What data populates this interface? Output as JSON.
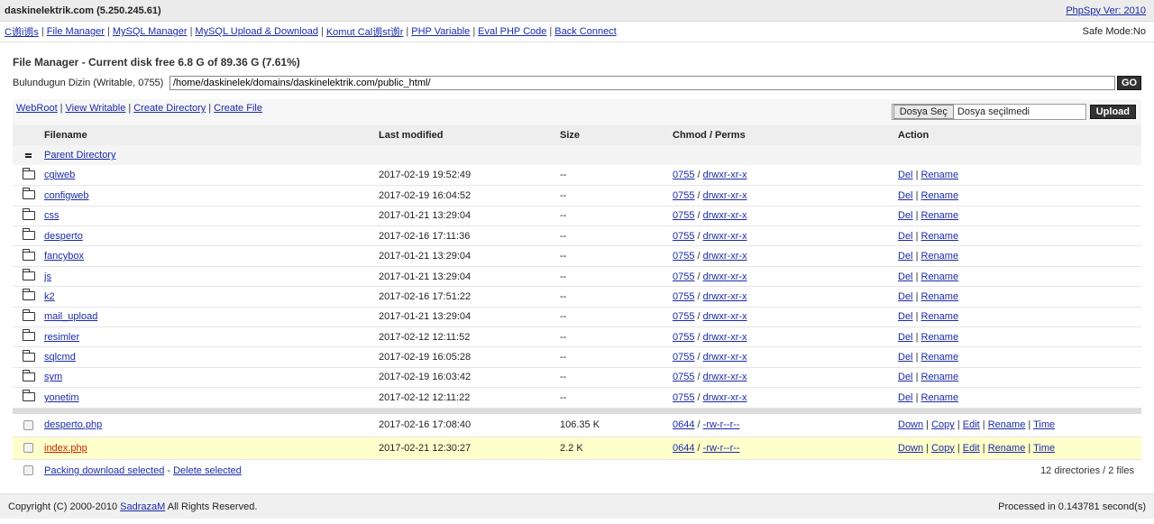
{
  "header": {
    "host": "daskinelektrik.com (5.250.245.61)",
    "version_link": "PhpSpy Ver: 2010"
  },
  "nav": {
    "items": [
      "C谫i谫s",
      "File Manager",
      "MySQL Manager",
      "MySQL Upload & Download",
      "Komut Cal谫st谫r",
      "PHP Variable",
      "Eval PHP Code",
      "Back Connect"
    ],
    "separator": "|",
    "safe_mode": "Safe Mode:No"
  },
  "main": {
    "title": "File Manager - Current disk free 6.8 G of 89.36 G (7.61%)",
    "dir_label": "Bulundugun Dizin (Writable, 0755)",
    "dir_value": "/home/daskinelek/domains/daskinelektrik.com/public_html/",
    "go_label": "GO"
  },
  "toolbar": {
    "links": [
      "WebRoot",
      "View Writable",
      "Create Directory",
      "Create File"
    ],
    "file_button": "Dosya Seç",
    "file_status": "Dosya seçilmedi",
    "upload_label": "Upload"
  },
  "table": {
    "headers": [
      "Filename",
      "Last modified",
      "Size",
      "Chmod / Perms",
      "Action"
    ],
    "parent": "Parent Directory",
    "directories": [
      {
        "name": "cgiweb",
        "modified": "2017-02-19 19:52:49",
        "size": "--",
        "chmod": "0755",
        "perms": "drwxr-xr-x"
      },
      {
        "name": "configweb",
        "modified": "2017-02-19 16:04:52",
        "size": "--",
        "chmod": "0755",
        "perms": "drwxr-xr-x"
      },
      {
        "name": "css",
        "modified": "2017-01-21 13:29:04",
        "size": "--",
        "chmod": "0755",
        "perms": "drwxr-xr-x"
      },
      {
        "name": "desperto",
        "modified": "2017-02-16 17:11:36",
        "size": "--",
        "chmod": "0755",
        "perms": "drwxr-xr-x"
      },
      {
        "name": "fancybox",
        "modified": "2017-01-21 13:29:04",
        "size": "--",
        "chmod": "0755",
        "perms": "drwxr-xr-x"
      },
      {
        "name": "js",
        "modified": "2017-01-21 13:29:04",
        "size": "--",
        "chmod": "0755",
        "perms": "drwxr-xr-x"
      },
      {
        "name": "k2",
        "modified": "2017-02-16 17:51:22",
        "size": "--",
        "chmod": "0755",
        "perms": "drwxr-xr-x"
      },
      {
        "name": "mail_upload",
        "modified": "2017-01-21 13:29:04",
        "size": "--",
        "chmod": "0755",
        "perms": "drwxr-xr-x"
      },
      {
        "name": "resimler",
        "modified": "2017-02-12 12:11:52",
        "size": "--",
        "chmod": "0755",
        "perms": "drwxr-xr-x"
      },
      {
        "name": "sqlcmd",
        "modified": "2017-02-19 16:05:28",
        "size": "--",
        "chmod": "0755",
        "perms": "drwxr-xr-x"
      },
      {
        "name": "sym",
        "modified": "2017-02-19 16:03:42",
        "size": "--",
        "chmod": "0755",
        "perms": "drwxr-xr-x"
      },
      {
        "name": "yonetim",
        "modified": "2017-02-12 12:11:22",
        "size": "--",
        "chmod": "0755",
        "perms": "drwxr-xr-x"
      }
    ],
    "dir_actions": [
      "Del",
      "Rename"
    ],
    "files": [
      {
        "name": "desperto.php",
        "modified": "2017-02-16 17:08:40",
        "size": "106.35 K",
        "chmod": "0644",
        "perms": "-rw-r--r--",
        "highlight": false
      },
      {
        "name": "index.php",
        "modified": "2017-02-21 12:30:27",
        "size": "2.2 K",
        "chmod": "0644",
        "perms": "-rw-r--r--",
        "highlight": true
      }
    ],
    "file_actions": [
      "Down",
      "Copy",
      "Edit",
      "Rename",
      "Time"
    ],
    "footer_links": [
      "Packing download selected",
      "Delete selected"
    ],
    "count": "12 directories / 2 files"
  },
  "footer": {
    "copyright_prefix": "Copyright (C) 2000-2010",
    "author": "SadrazaM",
    "copyright_suffix": "All Rights Reserved.",
    "processed": "Processed in 0.143781 second(s)"
  },
  "colors": {
    "link": "#1a2ba8",
    "highlight_row": "#ffffcc",
    "highlight_text": "#cc2200",
    "button_dark": "#333333"
  },
  "icons": {
    "folder": "folder-icon",
    "parent": "parent-dir-icon",
    "file_select": "checkbox"
  }
}
